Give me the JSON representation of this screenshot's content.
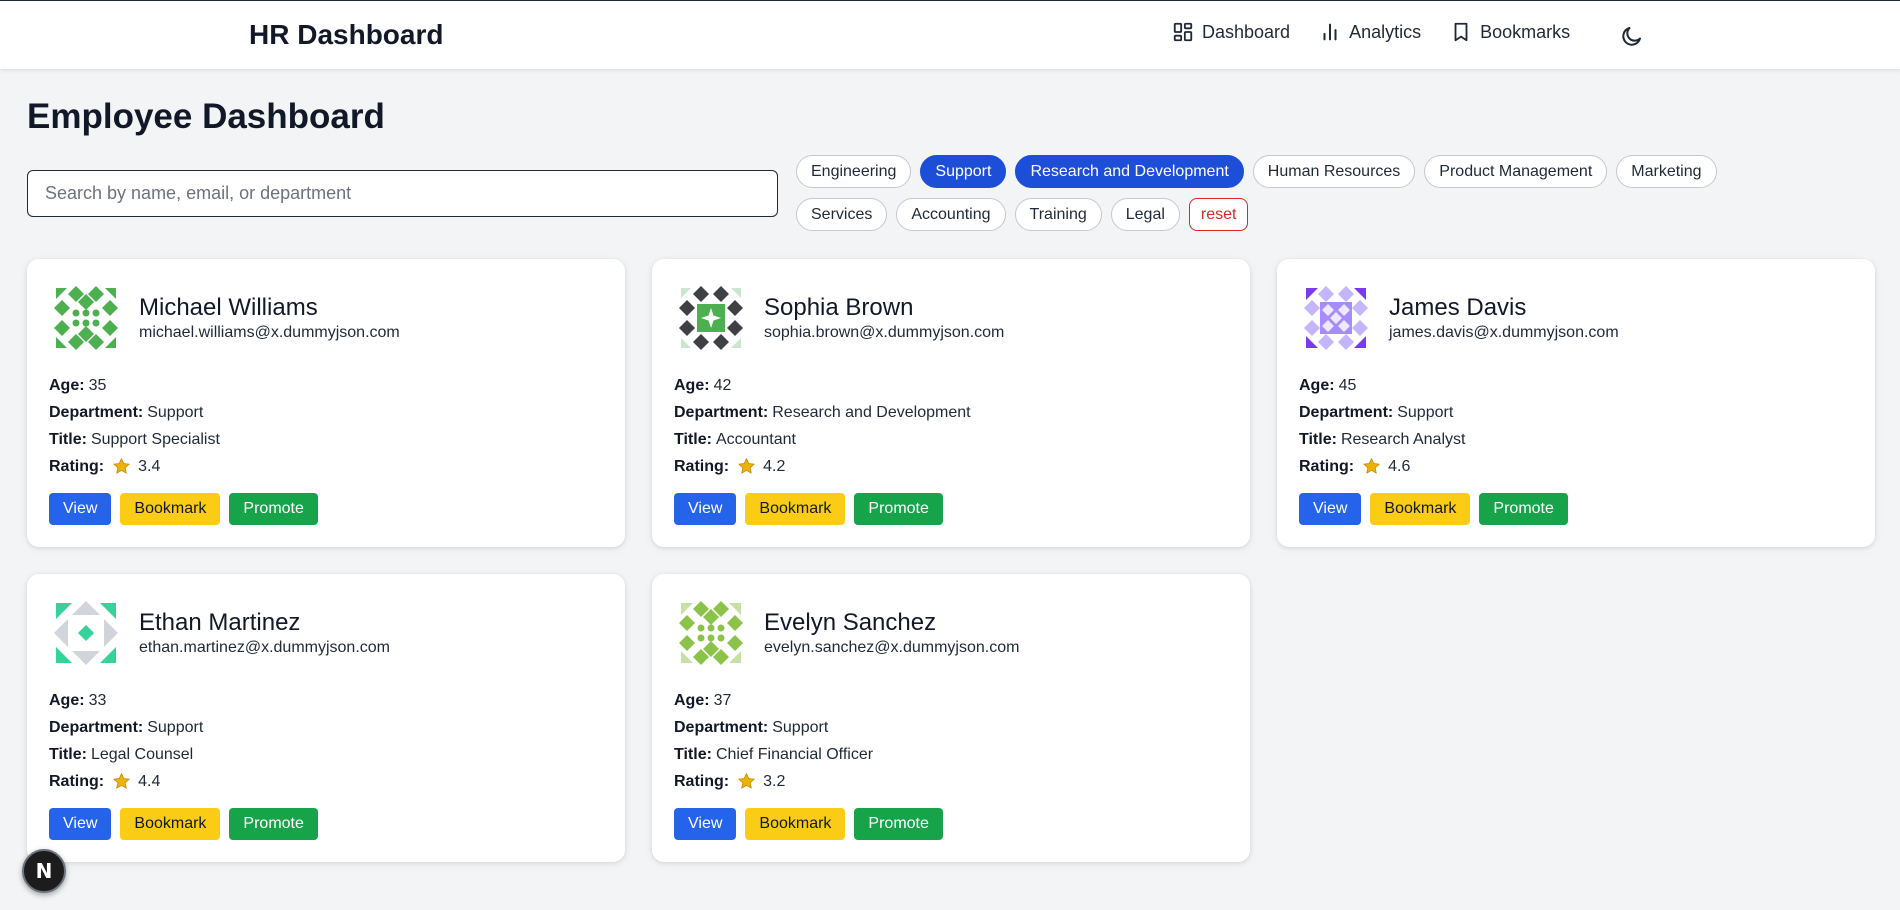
{
  "nav": {
    "brand": "HR Dashboard",
    "links": [
      {
        "label": "Dashboard",
        "icon": "dashboard-grid-icon"
      },
      {
        "label": "Analytics",
        "icon": "bar-chart-icon"
      },
      {
        "label": "Bookmarks",
        "icon": "bookmark-icon"
      }
    ],
    "theme_icon": "moon-icon"
  },
  "page": {
    "title": "Employee Dashboard",
    "search_placeholder": "Search by name, email, or department"
  },
  "filters": [
    {
      "label": "Engineering",
      "active": false
    },
    {
      "label": "Support",
      "active": true
    },
    {
      "label": "Research and Development",
      "active": true
    },
    {
      "label": "Human Resources",
      "active": false
    },
    {
      "label": "Product Management",
      "active": false
    },
    {
      "label": "Marketing",
      "active": false
    },
    {
      "label": "Services",
      "active": false
    },
    {
      "label": "Accounting",
      "active": false
    },
    {
      "label": "Training",
      "active": false
    },
    {
      "label": "Legal",
      "active": false
    }
  ],
  "reset_label": "reset",
  "labels": {
    "age": "Age:",
    "department": "Department:",
    "title": "Title:",
    "rating": "Rating:",
    "view": "View",
    "bookmark": "Bookmark",
    "promote": "Promote"
  },
  "employees": [
    {
      "name": "Michael Williams",
      "email": "michael.williams@x.dummyjson.com",
      "age": "35",
      "department": "Support",
      "title": "Support Specialist",
      "rating": "3.4"
    },
    {
      "name": "Sophia Brown",
      "email": "sophia.brown@x.dummyjson.com",
      "age": "42",
      "department": "Research and Development",
      "title": "Accountant",
      "rating": "4.2"
    },
    {
      "name": "James Davis",
      "email": "james.davis@x.dummyjson.com",
      "age": "45",
      "department": "Support",
      "title": "Research Analyst",
      "rating": "4.6"
    },
    {
      "name": "Ethan Martinez",
      "email": "ethan.martinez@x.dummyjson.com",
      "age": "33",
      "department": "Support",
      "title": "Legal Counsel",
      "rating": "4.4"
    },
    {
      "name": "Evelyn Sanchez",
      "email": "evelyn.sanchez@x.dummyjson.com",
      "age": "37",
      "department": "Support",
      "title": "Chief Financial Officer",
      "rating": "3.2"
    }
  ],
  "colors": {
    "primary": "#2563eb",
    "active_chip": "#1d4ed8",
    "bookmark": "#facc15",
    "promote": "#16a34a",
    "reset": "#dc2626",
    "star": "#eab308"
  },
  "framework_badge": "N"
}
